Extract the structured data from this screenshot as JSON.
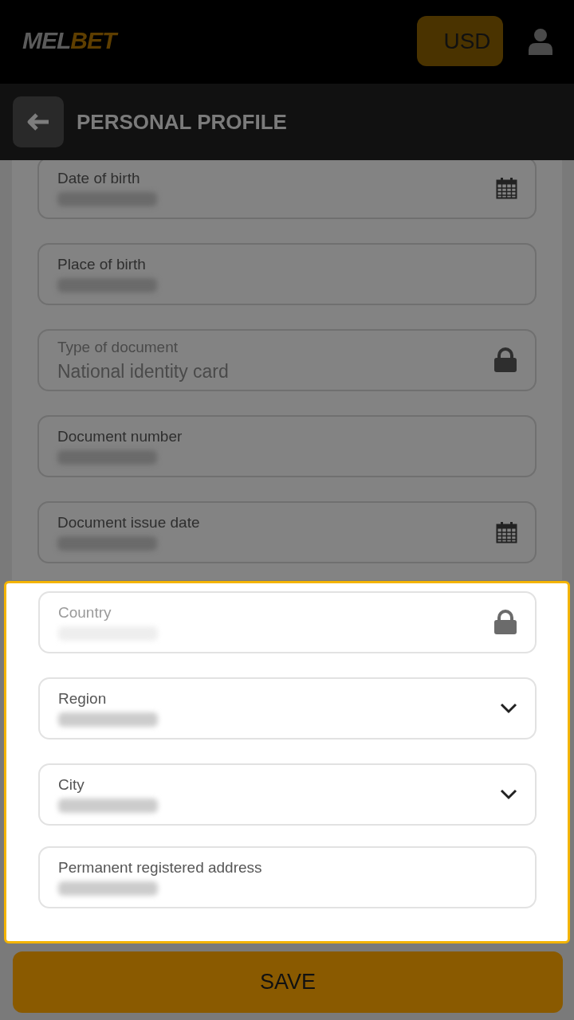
{
  "header": {
    "logo_left": "MEL",
    "logo_right": "BET",
    "currency": "USD"
  },
  "title": "PERSONAL PROFILE",
  "fields": [
    {
      "label": "Date of birth",
      "kind": "date",
      "redacted": true,
      "dimmed": true,
      "disabled": false
    },
    {
      "label": "Place of birth",
      "kind": "text",
      "redacted": true,
      "dimmed": true,
      "disabled": false
    },
    {
      "label": "Type of document",
      "kind": "locked",
      "value": "National identity card",
      "dimmed": true,
      "disabled": true
    },
    {
      "label": "Document number",
      "kind": "text",
      "redacted": true,
      "dimmed": true,
      "disabled": false
    },
    {
      "label": "Document issue date",
      "kind": "date",
      "redacted": true,
      "dimmed": true,
      "disabled": false
    },
    {
      "label": "Country",
      "kind": "locked",
      "redacted": true,
      "dimmed": false,
      "disabled": true
    },
    {
      "label": "Region",
      "kind": "select",
      "redacted": true,
      "dimmed": false,
      "disabled": false
    },
    {
      "label": "City",
      "kind": "select",
      "redacted": true,
      "dimmed": false,
      "disabled": false
    },
    {
      "label": "Permanent registered address",
      "kind": "text",
      "redacted": true,
      "dimmed": false,
      "disabled": false
    }
  ],
  "save": "SAVE"
}
